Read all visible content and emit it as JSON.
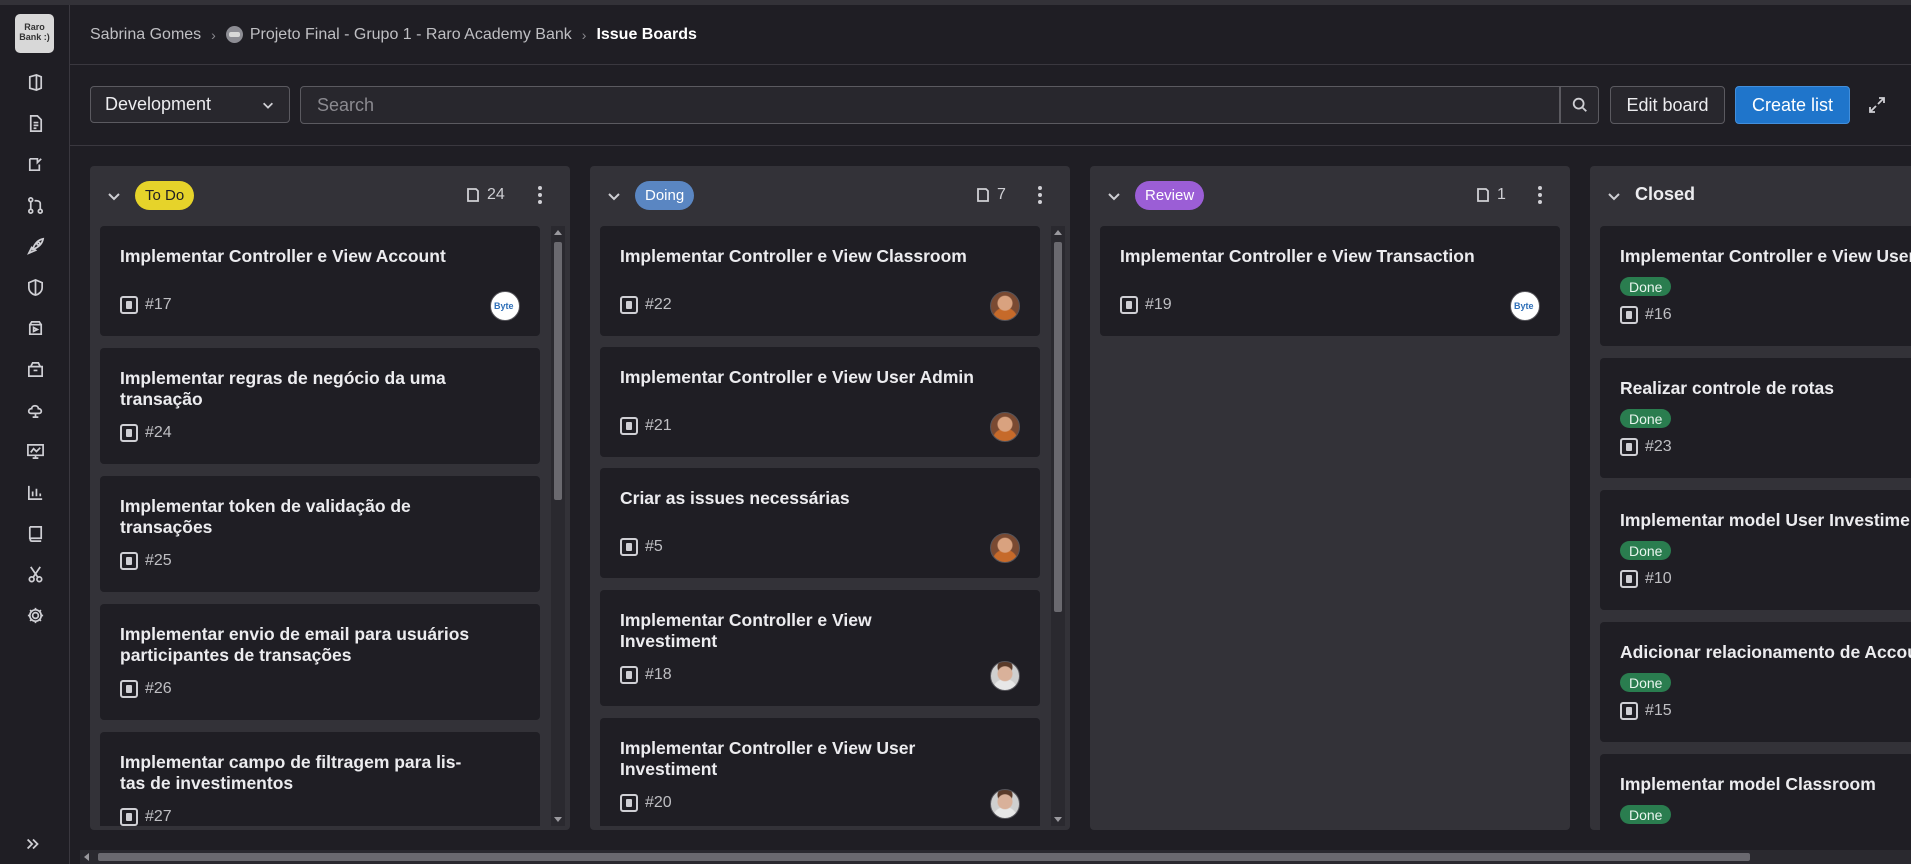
{
  "app": {
    "logo_text_1": "Raro",
    "logo_text_2": "Bank :)"
  },
  "breadcrumb": {
    "user": "Sabrina Gomes",
    "project": "Projeto Final - Grupo 1 - Raro Academy Bank",
    "current": "Issue Boards"
  },
  "sidebar": {
    "icons": [
      "project-icon",
      "issues-icon",
      "merge-requests-icon",
      "repository-icon",
      "deploy-icon",
      "security-icon",
      "ci-cd-icon",
      "packages-icon",
      "infrastructure-icon",
      "monitor-icon",
      "analytics-icon",
      "wiki-icon",
      "snippets-icon",
      "settings-icon"
    ]
  },
  "toolbar": {
    "board_select": "Development",
    "search_placeholder": "Search",
    "edit_board": "Edit board",
    "create_list": "Create list"
  },
  "colors": {
    "todo_label": "#e6d32a",
    "doing_label": "#5a86c2",
    "review_label": "#9b5ed6",
    "done_badge": "#2a7d4f",
    "primary_button": "#1f75cb"
  },
  "lists": [
    {
      "label": "To Do",
      "count": "24",
      "cards": [
        {
          "title": [
            "Implementar Controller e View Account"
          ],
          "ref": "#17",
          "avatar": "byte"
        },
        {
          "title": [
            "Implementar regras de negócio da uma",
            "transação"
          ],
          "ref": "#24"
        },
        {
          "title": [
            "Implementar token de validação de",
            "transações"
          ],
          "ref": "#25"
        },
        {
          "title": [
            "Implementar envio de email para usuários",
            "participantes de transações"
          ],
          "ref": "#26"
        },
        {
          "title": [
            "Implementar campo de filtragem para lis-",
            "tas de investimentos"
          ],
          "ref": "#27"
        }
      ]
    },
    {
      "label": "Doing",
      "count": "7",
      "cards": [
        {
          "title": [
            "Implementar Controller e View Classroom"
          ],
          "ref": "#22",
          "avatar": "woman"
        },
        {
          "title": [
            "Implementar Controller e View User Admin"
          ],
          "ref": "#21",
          "avatar": "woman"
        },
        {
          "title": [
            "Criar as issues necessárias"
          ],
          "ref": "#5",
          "avatar": "woman"
        },
        {
          "title": [
            "Implementar Controller e View",
            "Investiment"
          ],
          "ref": "#18",
          "avatar": "man"
        },
        {
          "title": [
            "Implementar Controller e View User",
            "Investiment"
          ],
          "ref": "#20",
          "avatar": "man"
        }
      ]
    },
    {
      "label": "Review",
      "count": "1",
      "cards": [
        {
          "title": [
            "Implementar Controller e View Transaction"
          ],
          "ref": "#19",
          "avatar": "byte"
        }
      ]
    },
    {
      "label": "Closed",
      "cards": [
        {
          "title": [
            "Implementar Controller e View User"
          ],
          "badge": "Done",
          "ref": "#16"
        },
        {
          "title": [
            "Realizar controle de rotas"
          ],
          "badge": "Done",
          "ref": "#23"
        },
        {
          "title": [
            "Implementar model User Investiment"
          ],
          "badge": "Done",
          "ref": "#10"
        },
        {
          "title": [
            "Adicionar relacionamento de Account"
          ],
          "badge": "Done",
          "ref": "#15"
        },
        {
          "title": [
            "Implementar model Classroom"
          ],
          "badge": "Done"
        }
      ]
    }
  ]
}
